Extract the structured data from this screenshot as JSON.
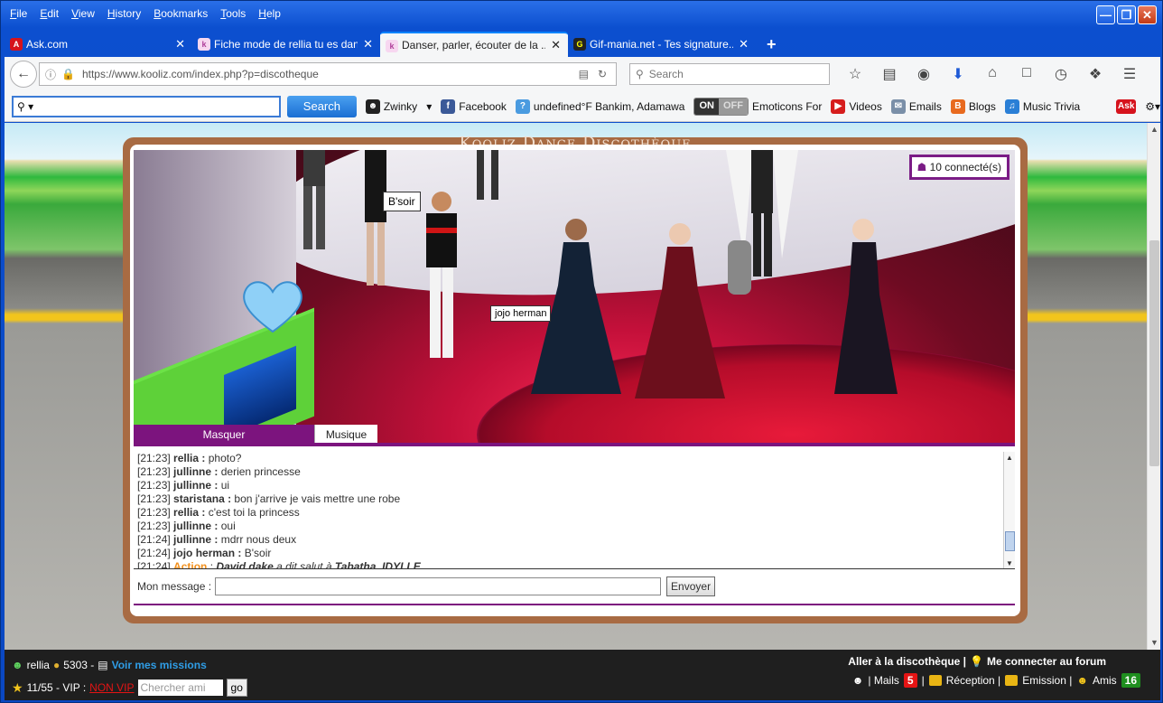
{
  "menubar": {
    "items": [
      "File",
      "Edit",
      "View",
      "History",
      "Bookmarks",
      "Tools",
      "Help"
    ]
  },
  "tabs": [
    {
      "label": "Ask.com",
      "icon": "ask-icon",
      "active": false
    },
    {
      "label": "Fiche mode de rellia tu es dan...",
      "icon": "kooliz-icon",
      "active": false
    },
    {
      "label": "Danser, parler, écouter de la ...",
      "icon": "kooliz-icon",
      "active": true
    },
    {
      "label": "Gif-mania.net - Tes signature...",
      "icon": "gifmania-icon",
      "active": false
    }
  ],
  "navbar": {
    "url": "https://www.kooliz.com/index.php?p=discotheque",
    "search_placeholder": "Search"
  },
  "asktoolbar": {
    "search_button": "Search",
    "items": [
      "Zwinky",
      "Facebook",
      "undefined°F Bankim, Adamawa",
      "Emoticons For",
      "Videos",
      "Emails",
      "Blogs",
      "Music Trivia"
    ],
    "toggle_on": "ON",
    "toggle_off": "OFF"
  },
  "page": {
    "title": "Kooliz Dance Discothèque",
    "connected": "10 connecté(s)",
    "bubble_bsoir": "B'soir",
    "name_label": "jojo herman",
    "tab_masquer": "Masquer",
    "tab_musique": "Musique"
  },
  "chat": [
    {
      "time": "[21:23]",
      "user": "rellia :",
      "msg": "photo?"
    },
    {
      "time": "[21:23]",
      "user": "jullinne :",
      "msg": "derien princesse"
    },
    {
      "time": "[21:23]",
      "user": "jullinne :",
      "msg": "ui"
    },
    {
      "time": "[21:23]",
      "user": "staristana :",
      "msg": "bon j'arrive je vais mettre une robe"
    },
    {
      "time": "[21:23]",
      "user": "rellia :",
      "msg": "c'est toi la princess"
    },
    {
      "time": "[21:23]",
      "user": "jullinne :",
      "msg": "oui"
    },
    {
      "time": "[21:24]",
      "user": "jullinne :",
      "msg": "mdrr nous deux"
    },
    {
      "time": "[21:24]",
      "user": "jojo herman :",
      "msg": "B'soir"
    }
  ],
  "chat_action": {
    "time": "[21:24]",
    "label": "Action",
    "actor": "David dake",
    "text": "a dit salut à",
    "target": "Tabatha_IDYLLE"
  },
  "message": {
    "label": "Mon message :",
    "send": "Envoyer"
  },
  "statusbar": {
    "username": "rellia",
    "coins": "5303 -",
    "missions": "Voir mes missions",
    "level": "11/55 - VIP :",
    "vip_status": "NON VIP",
    "search_friend_placeholder": "Chercher ami",
    "go": "go",
    "go_disco": "Aller à la discothèque |",
    "forum": "Me connecter au forum",
    "mails_label": "| Mails",
    "mails_count": "5",
    "reception": "Réception |",
    "emission": "Emission |",
    "amis_label": "Amis",
    "amis_count": "16",
    "sep": "|"
  },
  "colors": {
    "window": "#0c4fcf",
    "accent_purple": "#7c147e",
    "frame_brown": "#a86b43",
    "search_blue": "#1a6fd3"
  }
}
